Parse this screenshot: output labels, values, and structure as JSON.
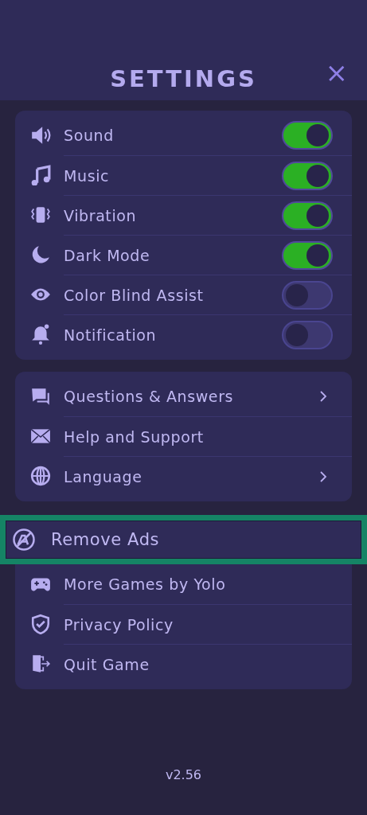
{
  "header": {
    "title": "SETTINGS",
    "close": "×"
  },
  "groups": [
    {
      "items": [
        {
          "kind": "toggle",
          "label": "Sound",
          "on": true
        },
        {
          "kind": "toggle",
          "label": "Music",
          "on": true
        },
        {
          "kind": "toggle",
          "label": "Vibration",
          "on": true
        },
        {
          "kind": "toggle",
          "label": "Dark Mode",
          "on": true
        },
        {
          "kind": "toggle",
          "label": "Color Blind Assist",
          "on": false
        },
        {
          "kind": "toggle",
          "label": "Notification",
          "on": false
        }
      ]
    },
    {
      "items": [
        {
          "kind": "nav",
          "label": "Questions & Answers"
        },
        {
          "kind": "plain",
          "label": "Help and Support"
        },
        {
          "kind": "nav",
          "label": "Language"
        }
      ]
    },
    {
      "items": [
        {
          "kind": "plain",
          "label": "Remove Ads",
          "selected": true
        },
        {
          "kind": "plain",
          "label": "More Games by Yolo",
          "selected": false
        },
        {
          "kind": "plain",
          "label": "Privacy Policy",
          "selected": false
        },
        {
          "kind": "plain",
          "label": "Quit Game",
          "selected": false
        }
      ]
    }
  ],
  "version": "v2.56"
}
